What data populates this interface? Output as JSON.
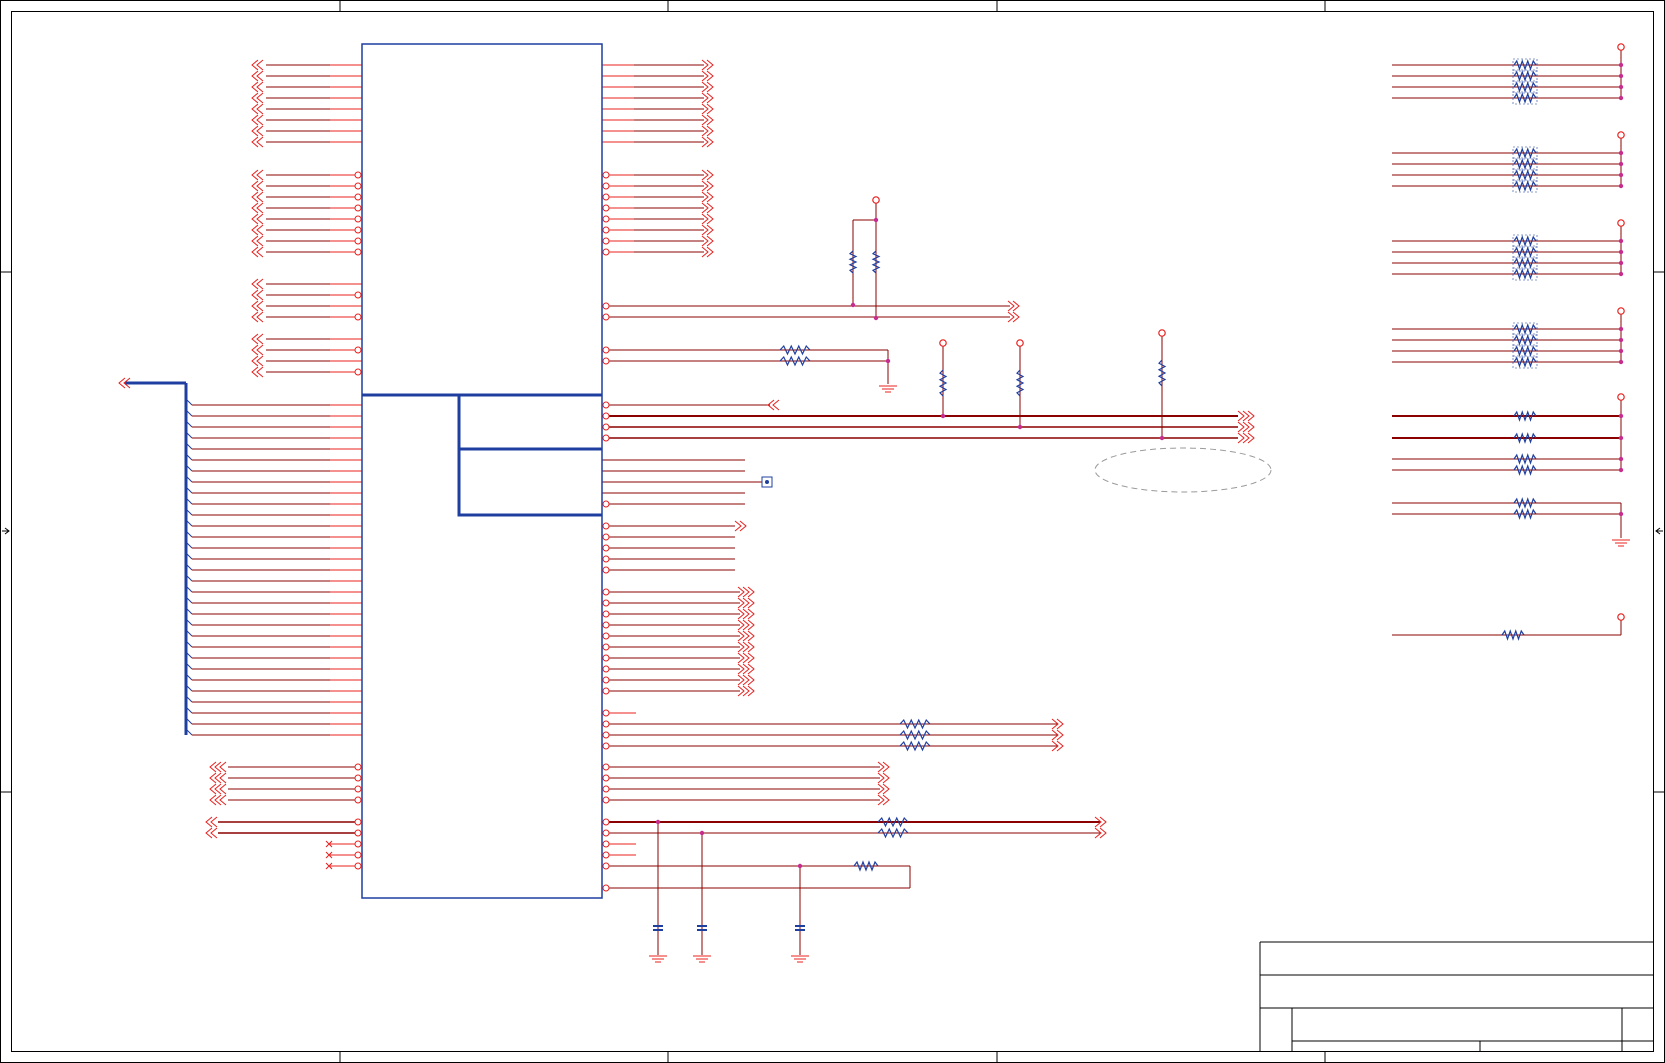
{
  "sheet": {
    "background": "#ffffff",
    "frame_color": "#000000",
    "wire_color": "#8b0000",
    "pin_color": "#e8201e",
    "part_color": "#1f3fa0",
    "junction_color": "#c62d8f",
    "note_outline_color": "#9a9a9a"
  },
  "title_block": {
    "title": "",
    "size": "",
    "document_number": "",
    "revision": "",
    "date": "",
    "sheet_of": ""
  }
}
